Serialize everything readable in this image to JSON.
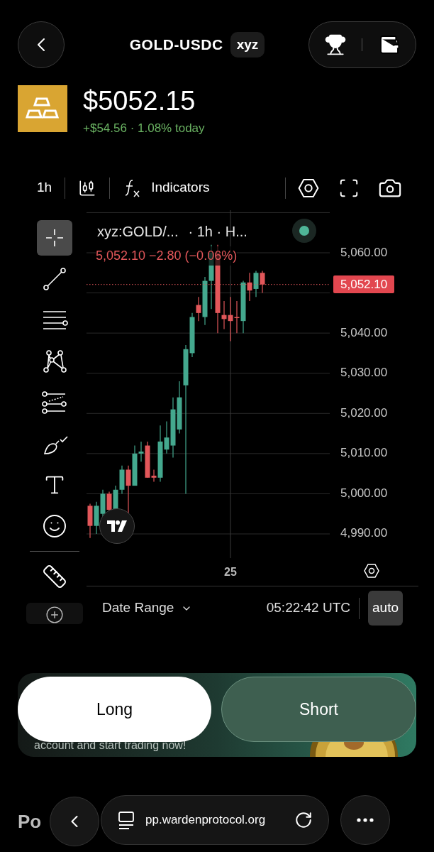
{
  "header": {
    "title": "GOLD-USDC",
    "badge": "xyz"
  },
  "asset": {
    "price": "$5052.15",
    "change": "+$54.56 · 1.08% today"
  },
  "toolbar": {
    "interval": "1h",
    "indicators": "Indicators"
  },
  "tools": [
    {
      "kind": "crosshair",
      "selected": true
    },
    {
      "kind": "trend-line",
      "selected": false
    },
    {
      "kind": "horizontal-lines",
      "selected": false
    },
    {
      "kind": "pattern",
      "selected": false
    },
    {
      "kind": "projection",
      "selected": false
    },
    {
      "kind": "brush",
      "selected": false
    },
    {
      "kind": "text",
      "selected": false
    },
    {
      "kind": "emoji",
      "selected": false
    },
    {
      "kind": "ruler",
      "selected": false
    },
    {
      "kind": "zoom",
      "selected": false
    }
  ],
  "chart": {
    "legend_symbol": "xyz:GOLD/...",
    "legend_interval": "· 1h · H...",
    "ohlc": "5,052.10 −2.80 (−0.06%)",
    "price_tag": "5,052.10",
    "price_axis": [
      "5,060.00",
      "5,040.00",
      "5,030.00",
      "5,020.00",
      "5,010.00",
      "5,000.00",
      "4,990.00"
    ],
    "time_axis": [
      "25"
    ]
  },
  "chart_footer": {
    "date_range": "Date Range",
    "time": "05:22:42 UTC",
    "auto": {
      "label": "auto",
      "selected": true
    }
  },
  "banner": {
    "text": "account and start trading now!"
  },
  "actions": [
    {
      "label": "Long",
      "kind": "long"
    },
    {
      "label": "Short",
      "kind": "short"
    }
  ],
  "section_title": "Po",
  "browser": {
    "url": "pp.wardenprotocol.org"
  }
}
